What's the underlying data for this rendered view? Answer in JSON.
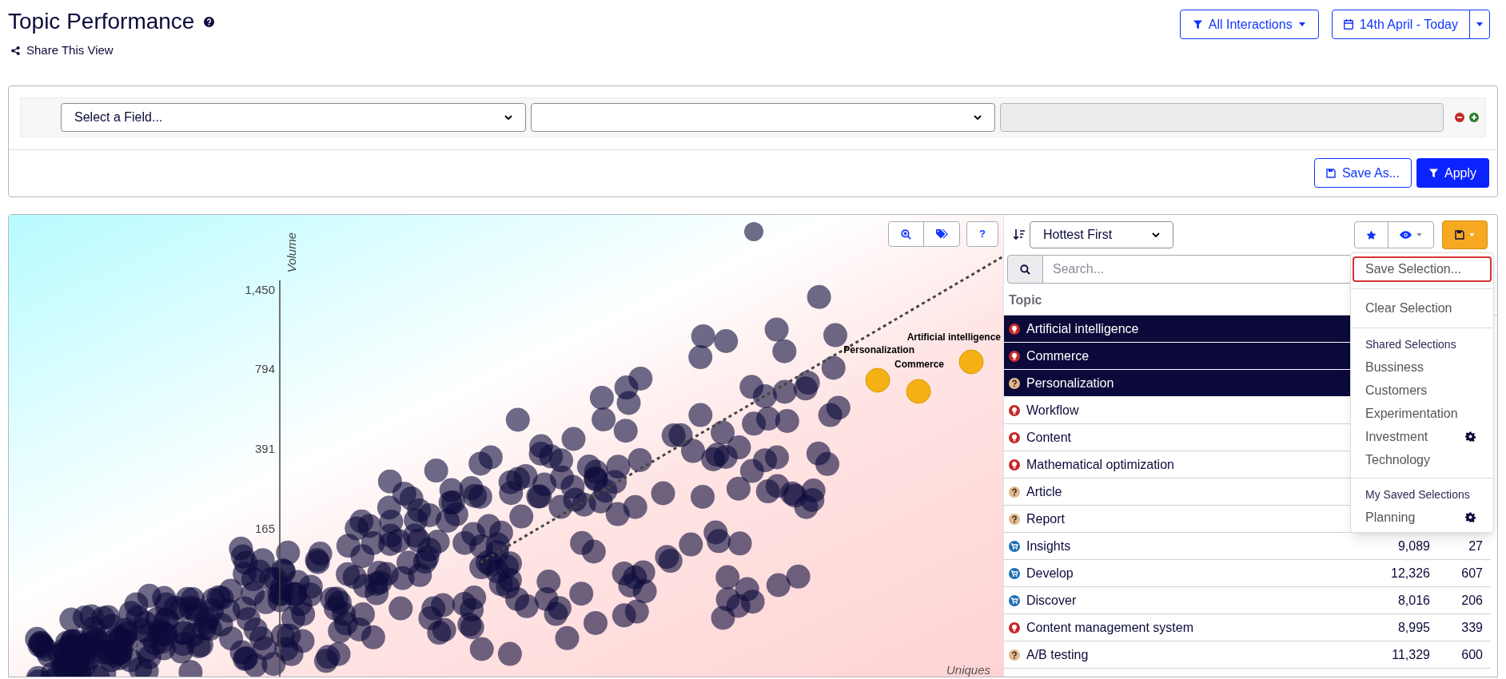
{
  "header": {
    "title": "Topic Performance",
    "share_link": "Share This View"
  },
  "toolbar": {
    "interactions_button": "All Interactions",
    "date_button": "14th April - Today"
  },
  "filter": {
    "field_select": "Select a Field...",
    "save_as_button": "Save As...",
    "apply_button": "Apply"
  },
  "chart": {
    "y_ticks": [
      "1,450",
      "794",
      "391",
      "165"
    ],
    "y_label": "Volume",
    "x_label": "Uniques",
    "help_button": "?",
    "highlighted_labels": [
      "Artificial intelligence",
      "Personalization",
      "Commerce"
    ]
  },
  "topic_list": {
    "sort_select": "Hottest First",
    "search_placeholder": "Search...",
    "column_header": "Topic",
    "rows": [
      {
        "kind": "hot",
        "topic": "Artificial intelligence",
        "selected": true
      },
      {
        "kind": "hot",
        "topic": "Commerce",
        "selected": true
      },
      {
        "kind": "unknown",
        "topic": "Personalization",
        "selected": true
      },
      {
        "kind": "hot",
        "topic": "Workflow",
        "selected": false
      },
      {
        "kind": "hot",
        "topic": "Content",
        "selected": false
      },
      {
        "kind": "hot",
        "topic": "Mathematical optimization",
        "selected": false
      },
      {
        "kind": "unknown",
        "topic": "Article",
        "selected": false
      },
      {
        "kind": "unknown",
        "topic": "Report",
        "selected": false
      },
      {
        "kind": "cart",
        "topic": "Insights",
        "selected": false,
        "column_2": "9,089",
        "column_3": "27"
      },
      {
        "kind": "cart",
        "topic": "Develop",
        "selected": false,
        "column_2": "12,326",
        "column_3": "607"
      },
      {
        "kind": "cart",
        "topic": "Discover",
        "selected": false,
        "column_2": "8,016",
        "column_3": "206"
      },
      {
        "kind": "hot",
        "topic": "Content management system",
        "selected": false,
        "column_2": "8,995",
        "column_3": "339"
      },
      {
        "kind": "unknown",
        "topic": "A/B testing",
        "selected": false,
        "column_2": "11,329",
        "column_3": "600"
      }
    ]
  },
  "save_menu": {
    "items": [
      {
        "kind": "action",
        "label": "Save Selection...",
        "focused": true
      },
      {
        "kind": "divider"
      },
      {
        "kind": "action",
        "label": "Clear Selection",
        "focused": false
      },
      {
        "kind": "divider"
      },
      {
        "kind": "header",
        "label": "Shared Selections"
      },
      {
        "kind": "option",
        "label": "Bussiness",
        "settings": false
      },
      {
        "kind": "option",
        "label": "Customers",
        "settings": false
      },
      {
        "kind": "option",
        "label": "Experimentation",
        "settings": false
      },
      {
        "kind": "option",
        "label": "Investment",
        "settings": true
      },
      {
        "kind": "option",
        "label": "Technology",
        "settings": false
      },
      {
        "kind": "divider"
      },
      {
        "kind": "header",
        "label": "My Saved Selections"
      },
      {
        "kind": "option",
        "label": "Planning",
        "settings": true
      }
    ]
  }
}
